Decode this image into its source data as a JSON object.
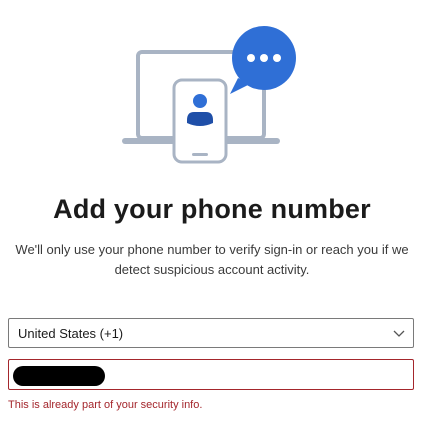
{
  "illustration": {
    "laptop_icon": "laptop-icon",
    "phone_icon": "phone-icon",
    "person_icon": "person-icon",
    "chat_icon": "chat-bubble-icon",
    "colors": {
      "accent": "#2f6fd6",
      "device_outline": "#a9b4c4",
      "device_fill": "#ffffff",
      "chat_bubble": "#2f6fd6"
    }
  },
  "header": {
    "title": "Add your phone number"
  },
  "description": "We'll only use your phone number to verify sign-in or reach you if we detect suspicious account activity.",
  "form": {
    "country": {
      "selected": "United States (+1)",
      "icon": "chevron-down-icon"
    },
    "phone": {
      "value": "",
      "redacted": true
    },
    "error": "This is already part of your security info."
  },
  "colors": {
    "error": "#a4262c",
    "border": "#7a7a7a",
    "text": "#1b1b1b"
  }
}
